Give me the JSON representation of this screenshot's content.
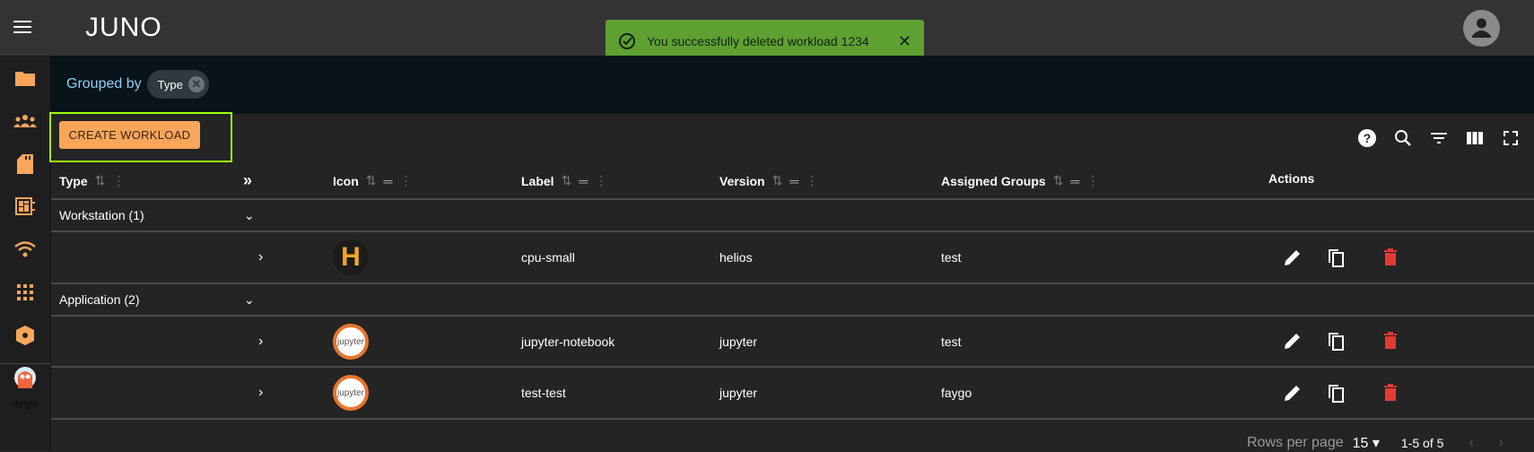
{
  "header": {
    "logo": "JUNO",
    "menu_icon": "hamburger-icon",
    "avatar_icon": "account-circle-icon"
  },
  "toast": {
    "message": "You successfully deleted workload 1234",
    "icon": "check-circle-icon",
    "color": "#5ea132"
  },
  "sidebar": {
    "items": [
      {
        "icon": "folder-icon"
      },
      {
        "icon": "groups-icon"
      },
      {
        "icon": "sd-card-icon"
      },
      {
        "icon": "dashboard-icon"
      },
      {
        "icon": "wifi-icon"
      },
      {
        "icon": "apps-grid-icon"
      },
      {
        "icon": "deployed-code-icon"
      },
      {
        "icon": "argo-logo",
        "label": "argo"
      }
    ],
    "accent": "#f9a65a"
  },
  "grouping": {
    "label": "Grouped by",
    "chip": "Type"
  },
  "toolbar": {
    "create_label": "CREATE WORKLOAD",
    "icons": [
      "help-icon",
      "search-icon",
      "filter-icon",
      "columns-icon",
      "fullscreen-icon"
    ]
  },
  "table": {
    "columns": [
      "Type",
      "Icon",
      "Label",
      "Version",
      "Assigned Groups",
      "Actions"
    ],
    "groups": [
      {
        "label": "Workstation (1)",
        "rows": [
          {
            "icon": "H",
            "label": "cpu-small",
            "version": "helios",
            "groups": "test"
          }
        ]
      },
      {
        "label": "Application (2)",
        "rows": [
          {
            "icon": "jupyter",
            "label": "jupyter-notebook",
            "version": "jupyter",
            "groups": "test"
          },
          {
            "icon": "jupyter",
            "label": "test-test",
            "version": "jupyter",
            "groups": "faygo"
          }
        ]
      }
    ]
  },
  "pagination": {
    "rows_per_page_label": "Rows per page",
    "rows_per_page": "15",
    "range": "1-5 of 5"
  },
  "colors": {
    "delete": "#e53935",
    "highlight": "#9eff00"
  }
}
